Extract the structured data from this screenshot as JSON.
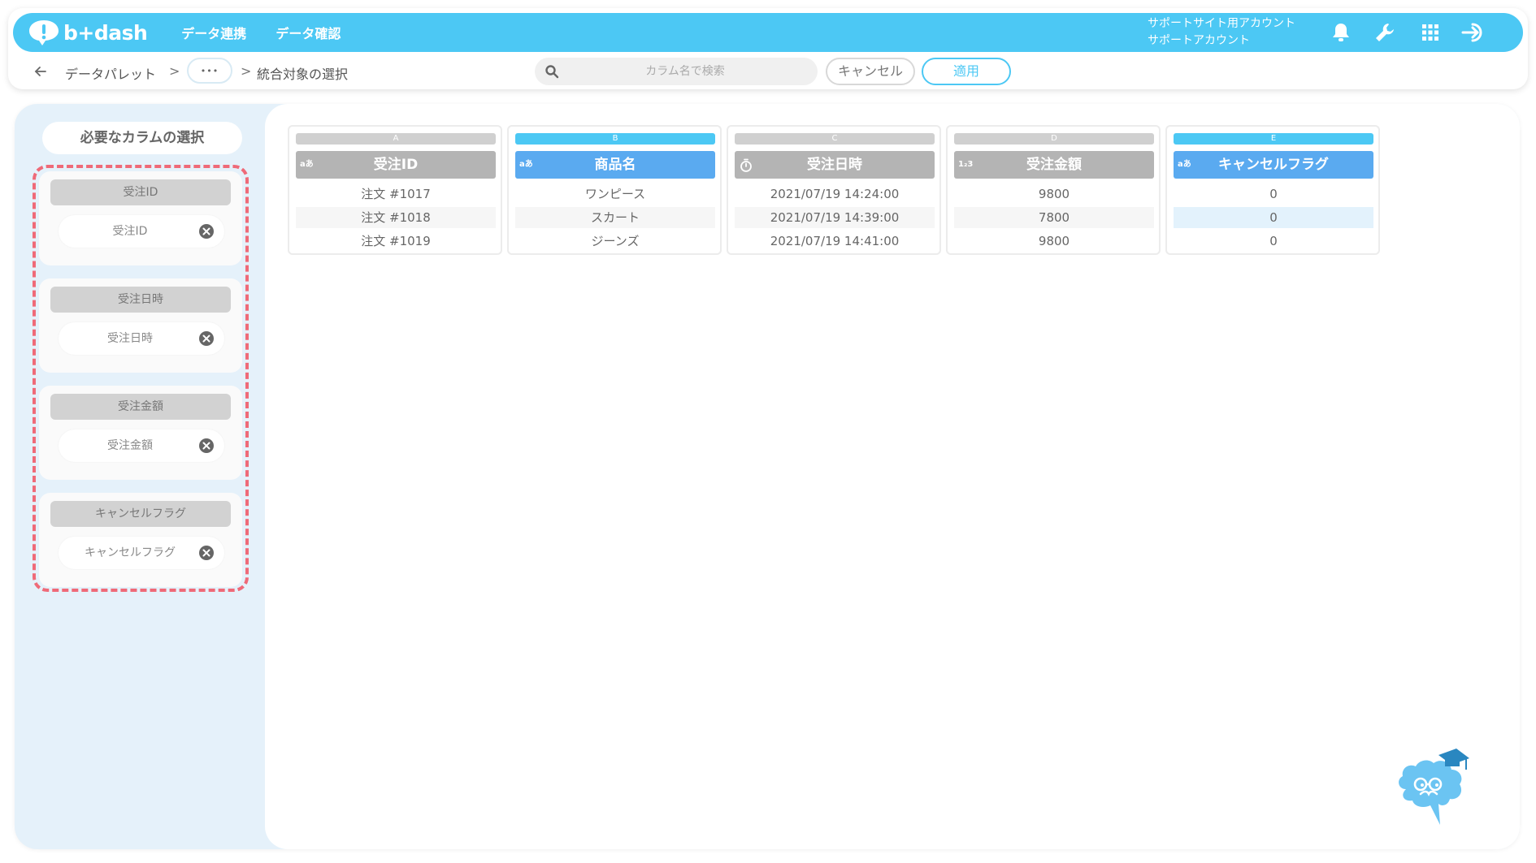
{
  "header": {
    "logo_text": "b+dash",
    "nav": [
      "データ連携",
      "データ確認"
    ],
    "user_line1": "サポートサイト用アカウント",
    "user_line2": "サポートアカウント"
  },
  "breadcrumb": {
    "item1": "データパレット",
    "sep": ">",
    "dots": "•••",
    "current": "統合対象の選択"
  },
  "search": {
    "placeholder": "カラム名で検索"
  },
  "actions": {
    "cancel": "キャンセル",
    "apply": "適用"
  },
  "sidebar": {
    "title": "必要なカラムの選択",
    "cards": [
      {
        "header": "受注ID",
        "chip": "受注ID"
      },
      {
        "header": "受注日時",
        "chip": "受注日時"
      },
      {
        "header": "受注金額",
        "chip": "受注金額"
      },
      {
        "header": "キャンセルフラグ",
        "chip": "キャンセルフラグ"
      }
    ]
  },
  "table": {
    "columns": [
      {
        "letter": "A",
        "type": "aあ",
        "name": "受注ID",
        "selected": false,
        "rows": [
          "注文 #1017",
          "注文 #1018",
          "注文 #1019"
        ]
      },
      {
        "letter": "B",
        "type": "aあ",
        "name": "商品名",
        "selected": true,
        "rows": [
          "ワンピース",
          "スカート",
          "ジーンズ"
        ]
      },
      {
        "letter": "C",
        "type": "clock",
        "name": "受注日時",
        "selected": false,
        "rows": [
          "2021/07/19 14:24:00",
          "2021/07/19 14:39:00",
          "2021/07/19 14:41:00"
        ]
      },
      {
        "letter": "D",
        "type": "1₂3",
        "name": "受注金額",
        "selected": false,
        "rows": [
          "9800",
          "7800",
          "9800"
        ]
      },
      {
        "letter": "E",
        "type": "aあ",
        "name": "キャンセルフラグ",
        "selected": true,
        "rows": [
          "0",
          "0",
          "0"
        ]
      }
    ]
  },
  "colors": {
    "brand": "#4cc8f4",
    "selected_header": "#5aaaf0",
    "unselected_header": "#b4b4b4",
    "dashed_border": "#ef6a78"
  }
}
